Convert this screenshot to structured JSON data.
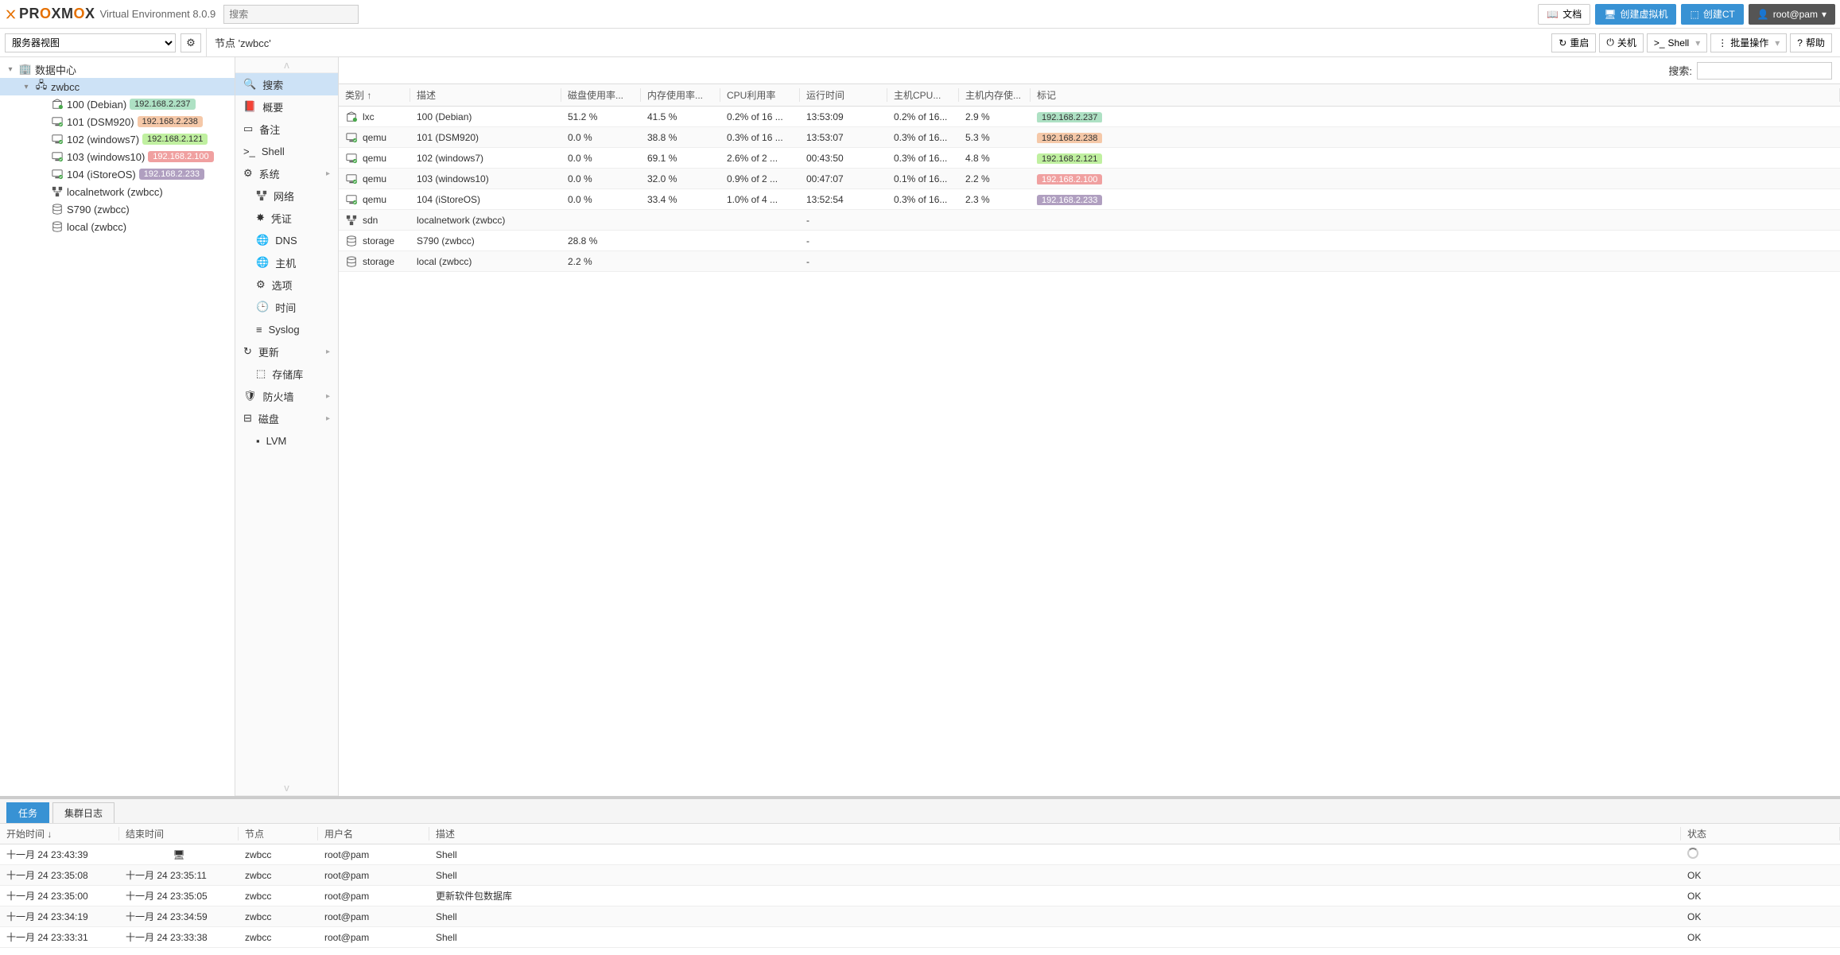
{
  "header": {
    "product": "PROXMOX",
    "subtitle": "Virtual Environment 8.0.9",
    "search_placeholder": "搜索",
    "docs": "文档",
    "create_vm": "创建虚拟机",
    "create_ct": "创建CT",
    "user": "root@pam"
  },
  "toolbar": {
    "view_option": "服务器视图",
    "breadcrumb": "节点 'zwbcc'",
    "reboot": "重启",
    "shutdown": "关机",
    "shell": "Shell",
    "bulk": "批量操作",
    "help": "帮助"
  },
  "tree": {
    "root": "数据中心",
    "node": "zwbcc",
    "items": [
      {
        "label": "100 (Debian)",
        "tag": "192.168.2.237",
        "tagClass": "tag1",
        "icon": "lxc"
      },
      {
        "label": "101 (DSM920)",
        "tag": "192.168.2.238",
        "tagClass": "tag2",
        "icon": "vm"
      },
      {
        "label": "102 (windows7)",
        "tag": "192.168.2.121",
        "tagClass": "tag3",
        "icon": "vm"
      },
      {
        "label": "103 (windows10)",
        "tag": "192.168.2.100",
        "tagClass": "tag4",
        "icon": "vm"
      },
      {
        "label": "104 (iStoreOS)",
        "tag": "192.168.2.233",
        "tagClass": "tag5",
        "icon": "vm"
      },
      {
        "label": "localnetwork (zwbcc)",
        "icon": "net"
      },
      {
        "label": "S790 (zwbcc)",
        "icon": "storage"
      },
      {
        "label": "local (zwbcc)",
        "icon": "storage"
      }
    ]
  },
  "menu": {
    "items": [
      {
        "label": "搜索",
        "icon": "search",
        "selected": true
      },
      {
        "label": "概要",
        "icon": "book"
      },
      {
        "label": "备注",
        "icon": "note"
      },
      {
        "label": "Shell",
        "icon": "shell"
      },
      {
        "label": "系统",
        "icon": "gear",
        "expandable": true
      },
      {
        "label": "网络",
        "icon": "net",
        "sub": true
      },
      {
        "label": "凭证",
        "icon": "cert",
        "sub": true
      },
      {
        "label": "DNS",
        "icon": "globe",
        "sub": true
      },
      {
        "label": "主机",
        "icon": "globe",
        "sub": true
      },
      {
        "label": "选项",
        "icon": "gear",
        "sub": true
      },
      {
        "label": "时间",
        "icon": "clock",
        "sub": true
      },
      {
        "label": "Syslog",
        "icon": "list",
        "sub": true
      },
      {
        "label": "更新",
        "icon": "refresh",
        "expandable": true
      },
      {
        "label": "存储库",
        "icon": "box",
        "sub": true
      },
      {
        "label": "防火墙",
        "icon": "shield",
        "expandable": true
      },
      {
        "label": "磁盘",
        "icon": "disk",
        "expandable": true
      },
      {
        "label": "LVM",
        "icon": "folder",
        "sub": true
      }
    ]
  },
  "grid": {
    "search_label": "搜索:",
    "headers": {
      "type": "类别 ↑",
      "desc": "描述",
      "disk": "磁盘使用率...",
      "mem": "内存使用率...",
      "cpu": "CPU利用率",
      "uptime": "运行时间",
      "hostcpu": "主机CPU...",
      "hostmem": "主机内存使...",
      "tags": "标记"
    },
    "rows": [
      {
        "icon": "lxc",
        "type": "lxc",
        "desc": "100 (Debian)",
        "disk": "51.2 %",
        "mem": "41.5 %",
        "cpu": "0.2% of 16 ...",
        "uptime": "13:53:09",
        "hostcpu": "0.2% of 16...",
        "hostmem": "2.9 %",
        "tag": "192.168.2.237",
        "tagClass": "tag1"
      },
      {
        "icon": "vm",
        "type": "qemu",
        "desc": "101 (DSM920)",
        "disk": "0.0 %",
        "mem": "38.8 %",
        "cpu": "0.3% of 16 ...",
        "uptime": "13:53:07",
        "hostcpu": "0.3% of 16...",
        "hostmem": "5.3 %",
        "tag": "192.168.2.238",
        "tagClass": "tag2"
      },
      {
        "icon": "vm",
        "type": "qemu",
        "desc": "102 (windows7)",
        "disk": "0.0 %",
        "mem": "69.1 %",
        "cpu": "2.6% of 2 ...",
        "uptime": "00:43:50",
        "hostcpu": "0.3% of 16...",
        "hostmem": "4.8 %",
        "tag": "192.168.2.121",
        "tagClass": "tag3"
      },
      {
        "icon": "vm",
        "type": "qemu",
        "desc": "103 (windows10)",
        "disk": "0.0 %",
        "mem": "32.0 %",
        "cpu": "0.9% of 2 ...",
        "uptime": "00:47:07",
        "hostcpu": "0.1% of 16...",
        "hostmem": "2.2 %",
        "tag": "192.168.2.100",
        "tagClass": "tag4"
      },
      {
        "icon": "vm",
        "type": "qemu",
        "desc": "104 (iStoreOS)",
        "disk": "0.0 %",
        "mem": "33.4 %",
        "cpu": "1.0% of 4 ...",
        "uptime": "13:52:54",
        "hostcpu": "0.3% of 16...",
        "hostmem": "2.3 %",
        "tag": "192.168.2.233",
        "tagClass": "tag5"
      },
      {
        "icon": "net",
        "type": "sdn",
        "desc": "localnetwork (zwbcc)",
        "disk": "",
        "mem": "",
        "cpu": "",
        "uptime": "-",
        "hostcpu": "",
        "hostmem": ""
      },
      {
        "icon": "storage",
        "type": "storage",
        "desc": "S790 (zwbcc)",
        "disk": "28.8 %",
        "mem": "",
        "cpu": "",
        "uptime": "-",
        "hostcpu": "",
        "hostmem": ""
      },
      {
        "icon": "storage",
        "type": "storage",
        "desc": "local (zwbcc)",
        "disk": "2.2 %",
        "mem": "",
        "cpu": "",
        "uptime": "-",
        "hostcpu": "",
        "hostmem": ""
      }
    ]
  },
  "tasks": {
    "tab_tasks": "任务",
    "tab_log": "集群日志",
    "headers": {
      "start": "开始时间 ↓",
      "end": "结束时间",
      "node": "节点",
      "user": "用户名",
      "desc": "描述",
      "status": "状态"
    },
    "rows": [
      {
        "start": "十一月 24 23:43:39",
        "end": "",
        "node": "zwbcc",
        "user": "root@pam",
        "desc": "Shell",
        "status": "",
        "running": true
      },
      {
        "start": "十一月 24 23:35:08",
        "end": "十一月 24 23:35:11",
        "node": "zwbcc",
        "user": "root@pam",
        "desc": "Shell",
        "status": "OK"
      },
      {
        "start": "十一月 24 23:35:00",
        "end": "十一月 24 23:35:05",
        "node": "zwbcc",
        "user": "root@pam",
        "desc": "更新软件包数据库",
        "status": "OK"
      },
      {
        "start": "十一月 24 23:34:19",
        "end": "十一月 24 23:34:59",
        "node": "zwbcc",
        "user": "root@pam",
        "desc": "Shell",
        "status": "OK"
      },
      {
        "start": "十一月 24 23:33:31",
        "end": "十一月 24 23:33:38",
        "node": "zwbcc",
        "user": "root@pam",
        "desc": "Shell",
        "status": "OK"
      }
    ]
  }
}
